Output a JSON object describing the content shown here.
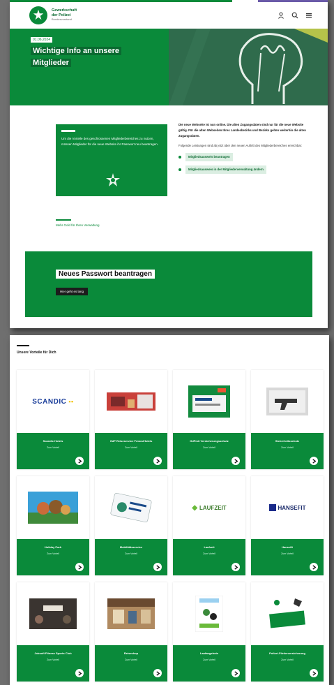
{
  "header": {
    "org_name_line1": "Gewerkschaft",
    "org_name_line2": "der Polizei",
    "org_sub": "Bundesvorstand"
  },
  "hero": {
    "date": "01.06.2024",
    "title": "Wichtige Info an unsere Mitglieder"
  },
  "info": {
    "box_text": "Um die Vorteile des geschlossenen Mitgliederbereiches zu nutzen, müssen Mitglieder für die neue Website ihr Passwort neu beantragen.",
    "text_bold": "Die neue Webseite ist nun online. Die alten Zugangsdaten sind nur für die neue Website gültig. Für die alten Webseiten Ihres Landesbezirks und Bezirks gelten weiterhin die alten Zugangsdaten.",
    "text_normal": "Folgende Leistungen sind ab jetzt über den neuen Auftritt des Mitgliederbereiches erreichbar:",
    "links": [
      "Mitgliedsausweis beantragen",
      "Mitgliedsausweis in der Mitgliederverwaltung ändern"
    ],
    "help_text": "Mehr Gold für Ihren Verwaltung"
  },
  "password": {
    "title": "Neues Passwort beantragen",
    "button": "Hier geht es lang"
  },
  "vorteile": {
    "title": "Unsere Vorteile für Dich",
    "cards": [
      {
        "name": "Scandic Hotels",
        "more": "Zum Vorteil",
        "logo": "SCANDIC"
      },
      {
        "name": "GdP Reiseservice Fewos/Hotels",
        "more": "Zum Vorteil",
        "logo": ""
      },
      {
        "name": "GdPmit Versicherungsschutz",
        "more": "Zum Vorteil",
        "logo": ""
      },
      {
        "name": "Sicherheitsschutz",
        "more": "Zum Vorteil",
        "logo": ""
      },
      {
        "name": "Holiday Park",
        "more": "Zum Vorteil",
        "logo": ""
      },
      {
        "name": "Mobilitätsservice",
        "more": "Zum Vorteil",
        "logo": ""
      },
      {
        "name": "Laufzeit",
        "more": "Zum Vorteil",
        "logo": "LAUFZEIT"
      },
      {
        "name": "Hansefit",
        "more": "Zum Vorteil",
        "logo": "HANSEFIT"
      },
      {
        "name": "Jobsoft Fitness Sports Club",
        "more": "Zum Vorteil",
        "logo": ""
      },
      {
        "name": "Reiseshop",
        "more": "Zum Vorteil",
        "logo": ""
      },
      {
        "name": "Laufangebote",
        "more": "Zum Vorteil",
        "logo": ""
      },
      {
        "name": "Polizei-Förderversicherung",
        "more": "Zum Vorteil",
        "logo": ""
      }
    ]
  },
  "colors": {
    "brand_green": "#0a8a3a",
    "dark_green": "#0a6a30"
  }
}
